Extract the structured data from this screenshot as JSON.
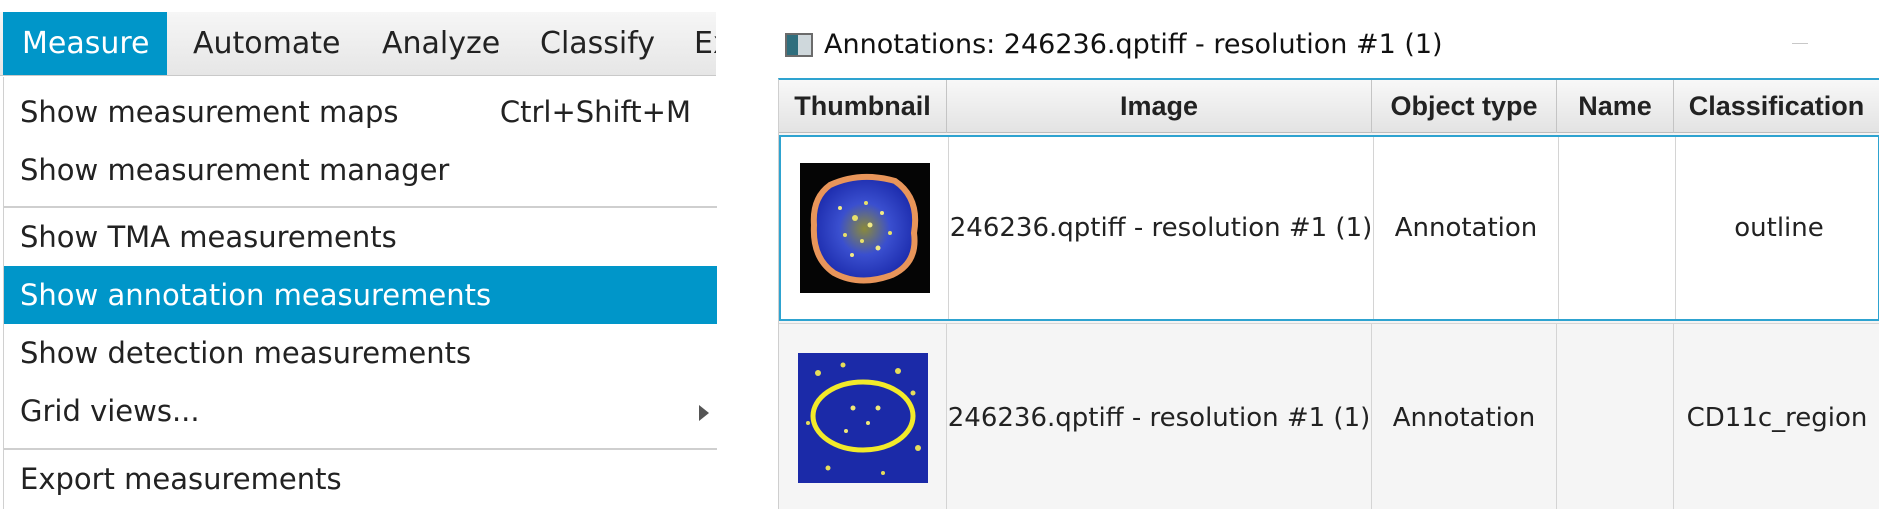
{
  "menubar": {
    "items": [
      {
        "label": "Measure",
        "active": true
      },
      {
        "label": "Automate"
      },
      {
        "label": "Analyze"
      },
      {
        "label": "Classify"
      },
      {
        "label": "Ex"
      }
    ]
  },
  "dropdown": {
    "items": [
      {
        "label": "Show measurement maps",
        "accelerator": "Ctrl+Shift+M"
      },
      {
        "label": "Show measurement manager"
      },
      {
        "label": "Show TMA measurements"
      },
      {
        "label": "Show annotation measurements",
        "selected": true
      },
      {
        "label": "Show detection measurements"
      },
      {
        "label": "Grid views...",
        "submenu": true
      },
      {
        "label": "Export measurements"
      }
    ],
    "selected_color": "#0096c9"
  },
  "window": {
    "title": "Annotations: 246236.qptiff - resolution #1 (1)",
    "icon": "app-window-icon"
  },
  "table": {
    "columns": [
      "Thumbnail",
      "Image",
      "Object type",
      "Name",
      "Classification"
    ],
    "rows": [
      {
        "thumbnail": "annotation-thumbnail-outline",
        "image": "246236.qptiff - resolution #1 (1)",
        "object_type": "Annotation",
        "name": "",
        "classification": "outline"
      },
      {
        "thumbnail": "annotation-thumbnail-cd11c",
        "image": "246236.qptiff - resolution #1 (1)",
        "object_type": "Annotation",
        "name": "",
        "classification": "CD11c_region"
      }
    ],
    "accent_color": "#2ea3d0"
  }
}
